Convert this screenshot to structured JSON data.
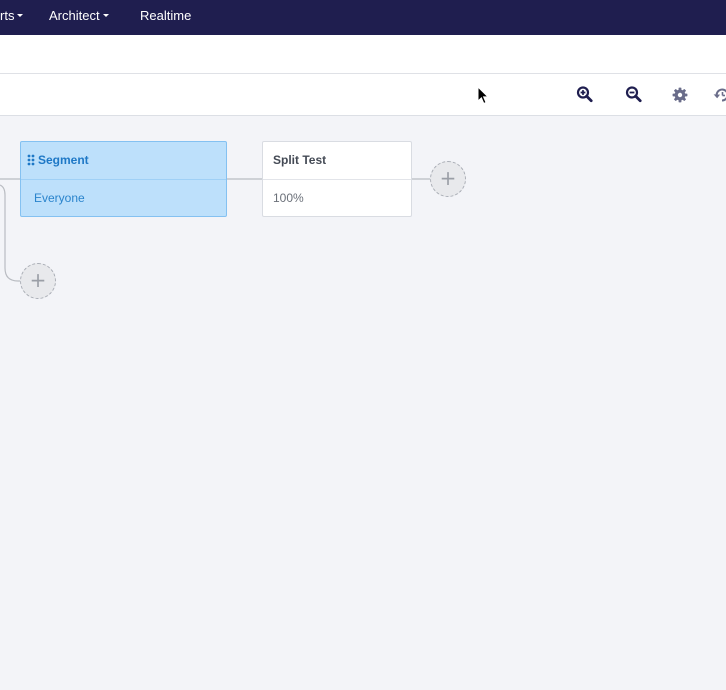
{
  "nav": {
    "items": [
      {
        "label": "rts",
        "has_caret": true
      },
      {
        "label": "Architect",
        "has_caret": true
      },
      {
        "label": "Realtime",
        "has_caret": false
      }
    ]
  },
  "toolbar": {
    "icons": [
      "zoom-in-icon",
      "zoom-out-icon",
      "gear-icon",
      "undo-icon"
    ]
  },
  "canvas": {
    "segment_node": {
      "title": "Segment",
      "value": "Everyone",
      "selected": true
    },
    "split_node": {
      "title": "Split Test",
      "value": "100%"
    },
    "add_symbol": "+"
  },
  "colors": {
    "nav_bg": "#1f1e4f",
    "canvas_bg": "#f3f4f8",
    "selected_fill": "#bde0fb",
    "selected_text": "#1e78c6",
    "icon_dark": "#1f1e4f",
    "icon_gray": "#6a6d8a"
  }
}
